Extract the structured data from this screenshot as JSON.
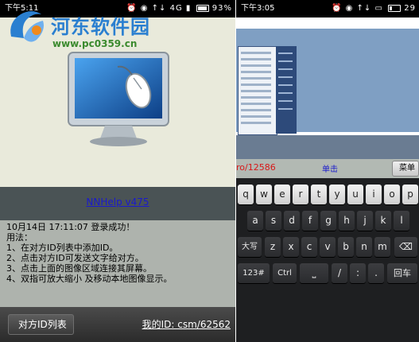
{
  "left": {
    "status": {
      "time": "下午5:11",
      "battery": "93%",
      "battery_level": 0.93,
      "icons": "⏰ ◉ ↑↓ 4G ▮"
    },
    "watermark": {
      "site_name": "河东软件园",
      "url": "www.pc0359.cn"
    },
    "app_title": "NNHelp v475",
    "log_lines": [
      "10月14日   17:11:07  登录成功！",
      "用法：",
      "1、在对方ID列表中添加ID。",
      "2、点击对方ID可发送文字给对方。",
      "3、点击上面的图像区域连接其屏幕。",
      "4、双指可放大缩小 及移动本地图像显示。"
    ],
    "back_button": "对方ID列表",
    "my_id": "我的ID: csm/62562"
  },
  "right": {
    "status": {
      "time": "下午3:05",
      "battery": "29",
      "battery_level": 0.29,
      "icons": "⏰ ◉ ↑↓ ▭"
    },
    "coord_text": "ro/12586",
    "click_label": "单击",
    "menu_label": "菜单",
    "keyboard": {
      "row1": [
        "q",
        "w",
        "e",
        "r",
        "t",
        "y",
        "u",
        "i",
        "o",
        "p"
      ],
      "row2": [
        "a",
        "s",
        "d",
        "f",
        "g",
        "h",
        "j",
        "k",
        "l"
      ],
      "row3": [
        "大写",
        "z",
        "x",
        "c",
        "v",
        "b",
        "n",
        "m",
        "⌫"
      ],
      "row4": [
        "123#",
        "Ctrl",
        "⎵",
        "/",
        ":",
        ".",
        "回车"
      ]
    }
  },
  "colors": {
    "watermark_blue": "#2a7fd0",
    "watermark_green": "#3b8a2e",
    "link_blue": "#1a1acc",
    "coord_red": "#d81818"
  }
}
